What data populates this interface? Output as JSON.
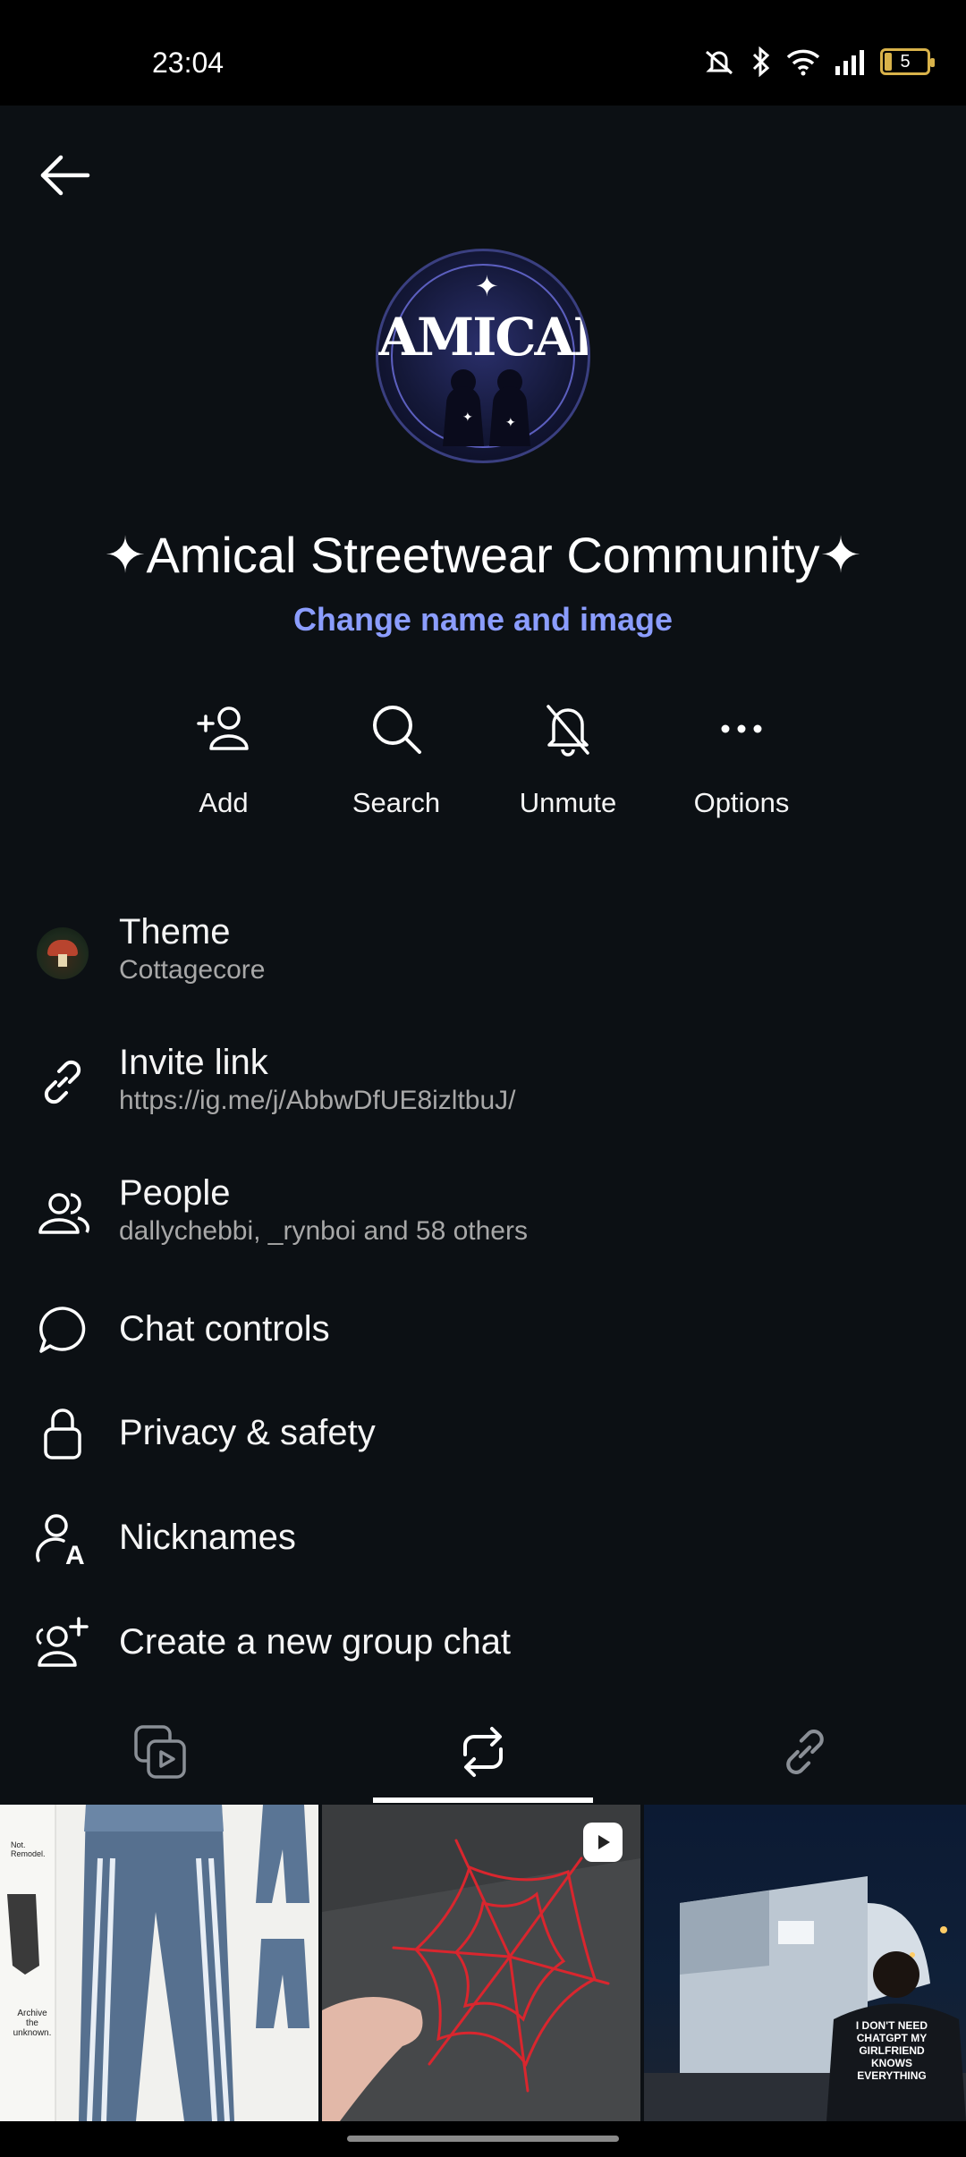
{
  "status_bar": {
    "time": "23:04",
    "battery_level": "5"
  },
  "header": {
    "back_icon": "arrow-left-icon"
  },
  "group": {
    "name": "✦Amical Streetwear Community✦",
    "change_label": "Change name and image",
    "avatar_text": "AMICAL"
  },
  "actions": [
    {
      "label": "Add",
      "icon": "add-person-icon"
    },
    {
      "label": "Search",
      "icon": "search-icon"
    },
    {
      "label": "Unmute",
      "icon": "bell-muted-icon"
    },
    {
      "label": "Options",
      "icon": "more-icon"
    }
  ],
  "menu": {
    "theme": {
      "title": "Theme",
      "subtitle": "Cottagecore"
    },
    "invite": {
      "title": "Invite link",
      "subtitle": "https://ig.me/j/AbbwDfUE8izltbuJ/"
    },
    "people": {
      "title": "People",
      "subtitle": "dallychebbi, _rynboi and 58 others"
    },
    "chat_controls": {
      "title": "Chat controls"
    },
    "privacy": {
      "title": "Privacy & safety"
    },
    "nicknames": {
      "title": "Nicknames"
    },
    "create_group": {
      "title": "Create a new group chat"
    }
  },
  "tabs": [
    {
      "name": "media",
      "icon": "photos-icon",
      "selected": false
    },
    {
      "name": "shared-posts",
      "icon": "repost-icon",
      "selected": true
    },
    {
      "name": "links",
      "icon": "link-icon",
      "selected": false
    }
  ],
  "media_thumbs": {
    "thumb1": {
      "caption_a": "Not. Remodel.",
      "caption_b": "Archive the unknown."
    },
    "thumb3": {
      "shirt_text": "I DON'T NEED CHATGPT MY GIRLFRIEND KNOWS EVERYTHING"
    }
  },
  "colors": {
    "background": "#0c1014",
    "accent_link": "#8b9dff",
    "secondary_text": "#a8a8a8"
  }
}
